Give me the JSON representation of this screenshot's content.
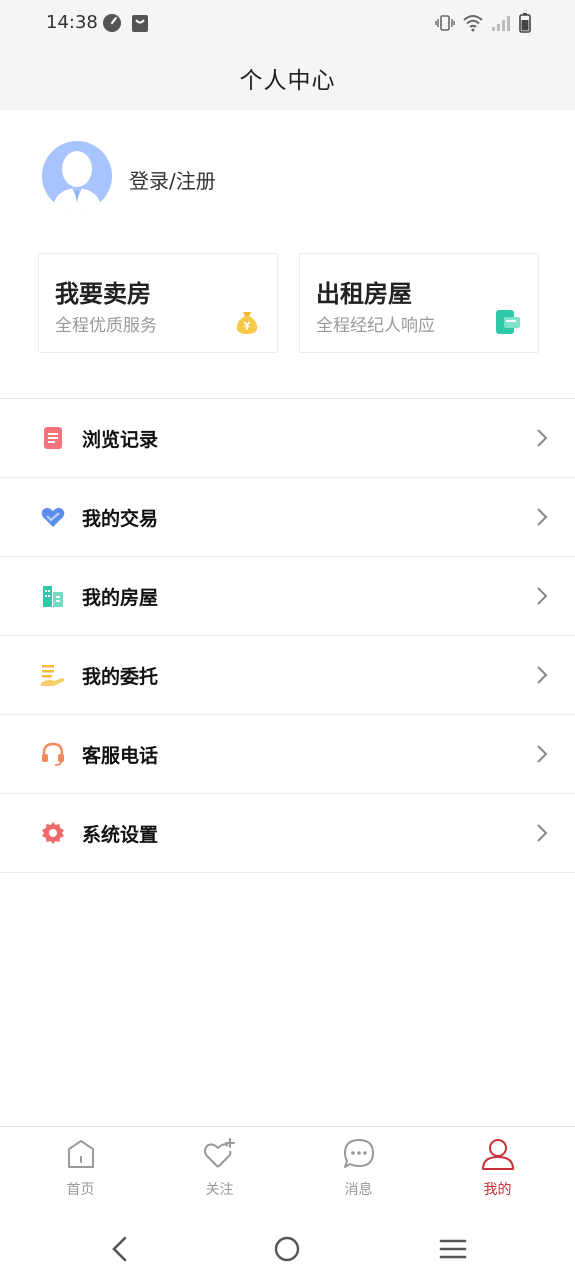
{
  "status_bar": {
    "time": "14:38"
  },
  "header": {
    "title": "个人中心"
  },
  "profile": {
    "login_label": "登录/注册"
  },
  "cards": [
    {
      "title": "我要卖房",
      "subtitle": "全程优质服务",
      "icon": "money-bag-icon"
    },
    {
      "title": "出租房屋",
      "subtitle": "全程经纪人响应",
      "icon": "wallet-icon"
    }
  ],
  "menu": [
    {
      "label": "浏览记录",
      "icon": "document-icon",
      "color": "#f2737b"
    },
    {
      "label": "我的交易",
      "icon": "handshake-heart-icon",
      "color": "#5b8def"
    },
    {
      "label": "我的房屋",
      "icon": "buildings-icon",
      "color": "#2ec9a8"
    },
    {
      "label": "我的委托",
      "icon": "hand-coins-icon",
      "color": "#f5b942"
    },
    {
      "label": "客服电话",
      "icon": "headset-icon",
      "color": "#f08a5d"
    },
    {
      "label": "系统设置",
      "icon": "gear-icon",
      "color": "#ef6b6b"
    }
  ],
  "tabs": [
    {
      "label": "首页",
      "icon": "home-icon",
      "active": false
    },
    {
      "label": "关注",
      "icon": "heart-plus-icon",
      "active": false
    },
    {
      "label": "消息",
      "icon": "chat-bubble-icon",
      "active": false
    },
    {
      "label": "我的",
      "icon": "user-icon",
      "active": true
    }
  ],
  "colors": {
    "accent": "#c8313a",
    "inactive": "#999999",
    "avatar": "#a8c4ff"
  }
}
